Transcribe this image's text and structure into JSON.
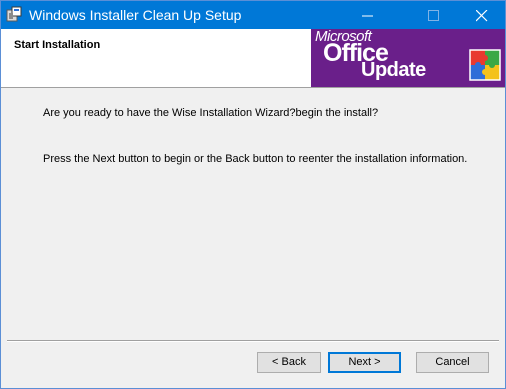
{
  "window": {
    "title": "Windows Installer Clean Up Setup",
    "icon": "installer-app-icon",
    "controls": {
      "minimize": "minimize-icon",
      "maximize": "maximize-icon",
      "close": "close-icon"
    }
  },
  "header": {
    "title": "Start Installation",
    "banner": {
      "line1": "Microsoft",
      "line2": "Office",
      "line3": "Update",
      "icon": "office-puzzle-icon"
    }
  },
  "body": {
    "paragraph1": "Are you ready to have the Wise Installation Wizard?begin the install?",
    "paragraph2": "Press the Next button to begin or the Back button to reenter the installation information."
  },
  "buttons": {
    "back": "< Back",
    "next": "Next >",
    "cancel": "Cancel"
  },
  "colors": {
    "titlebar": "#0078d7",
    "banner": "#6a1f8a",
    "focus": "#0078d7"
  }
}
